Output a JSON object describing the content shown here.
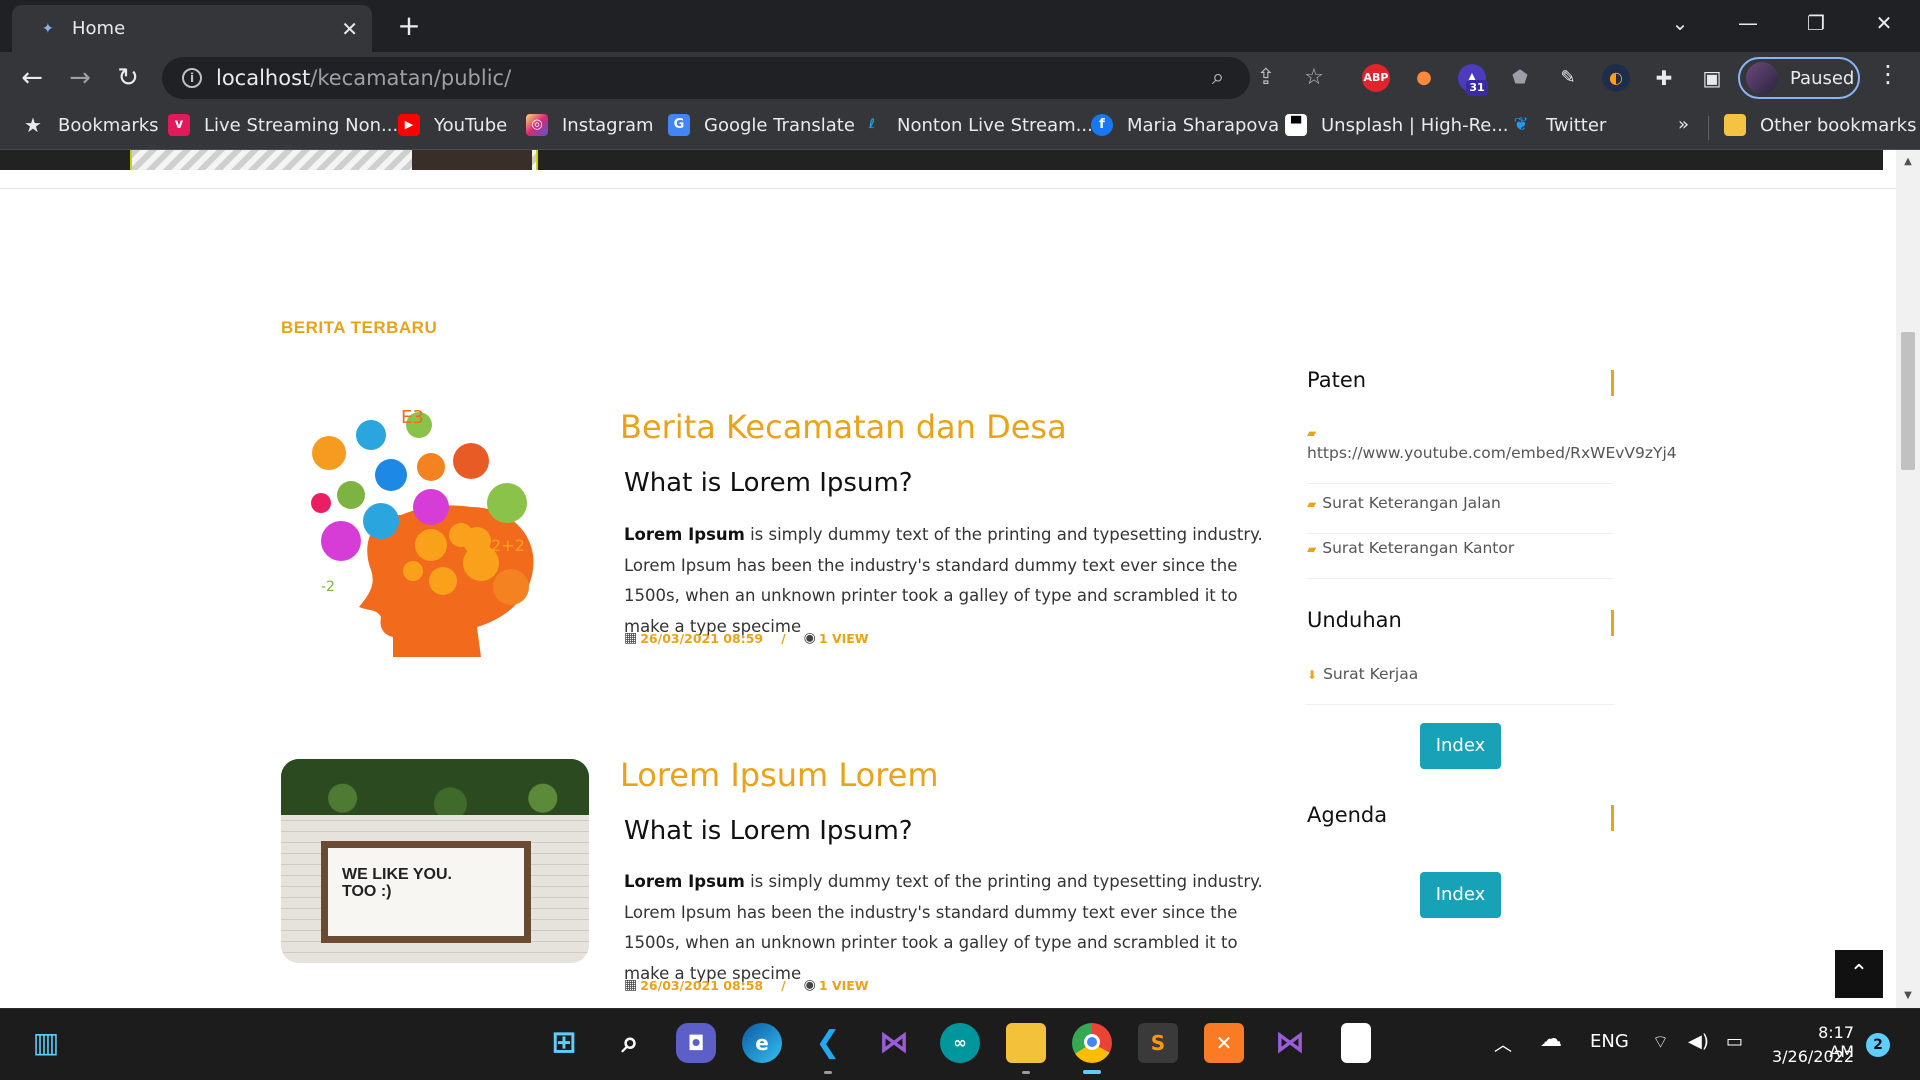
{
  "browser": {
    "tab_title": "Home",
    "url_host": "localhost",
    "url_path": "/kecamatan/public/",
    "profile_label": "Paused",
    "ext_abp": "ABP",
    "ext_badge": "31"
  },
  "bookmarks": {
    "bookmarks_label": "Bookmarks",
    "items": [
      {
        "label": "Live Streaming Non...",
        "icon": "vidio-icon",
        "color": "#e2195a"
      },
      {
        "label": "YouTube",
        "icon": "youtube-icon",
        "color": "#ff0000"
      },
      {
        "label": "Instagram",
        "icon": "instagram-icon",
        "color": "#d62976"
      },
      {
        "label": "Google Translate",
        "icon": "google-translate-icon",
        "color": "#4285f4"
      },
      {
        "label": "Nonton Live Stream...",
        "icon": "stream-icon",
        "color": "#1aa1e4"
      },
      {
        "label": "Maria Sharapova",
        "icon": "facebook-icon",
        "color": "#1877f2"
      },
      {
        "label": "Unsplash | High-Re...",
        "icon": "unsplash-icon",
        "color": "#000000"
      },
      {
        "label": "Twitter",
        "icon": "twitter-icon",
        "color": "#1d9bf0"
      }
    ],
    "overflow": "»",
    "other_label": "Other bookmarks"
  },
  "page": {
    "section_label": "BERITA TERBARU",
    "accent_color": "#e9a21a",
    "posts": [
      {
        "title": "Berita Kecamatan dan Desa",
        "subtitle": "What is Lorem Ipsum?",
        "body_bold": "Lorem Ipsum",
        "body": " is simply dummy text of the printing and typesetting industry. Lorem Ipsum has been the industry's standard dummy text ever since the 1500s, when an unknown printer took a galley of type and scrambled it to make a type specime",
        "date": "26/03/2021 08:59",
        "separator": "/",
        "views": "1 VIEW"
      },
      {
        "title": "Lorem Ipsum Lorem",
        "subtitle": "What is Lorem Ipsum?",
        "body_bold": "Lorem Ipsum",
        "body": " is simply dummy text of the printing and typesetting industry. Lorem Ipsum has been the industry's standard dummy text ever since the 1500s, when an unknown printer took a galley of type and scrambled it to make a type specime",
        "date": "26/03/2021 08:58",
        "separator": "/",
        "views": "1 VIEW",
        "image_text_1": "WE LIKE YOU.",
        "image_text_2": "TOO :)"
      }
    ]
  },
  "sidebar": {
    "paten_title": "Paten",
    "paten_items": [
      "https://www.youtube.com/embed/RxWEvV9zYj4",
      "Surat Keterangan Jalan",
      "Surat Keterangan Kantor"
    ],
    "unduhan_title": "Unduhan",
    "unduhan_items": [
      "Surat Kerjaa"
    ],
    "index_button": "Index",
    "agenda_title": "Agenda",
    "agenda_button": "Index",
    "button_color": "#17a2b8"
  },
  "taskbar": {
    "language": "ENG",
    "time": "8:17 AM",
    "date": "3/26/2022",
    "notifications": "2"
  }
}
